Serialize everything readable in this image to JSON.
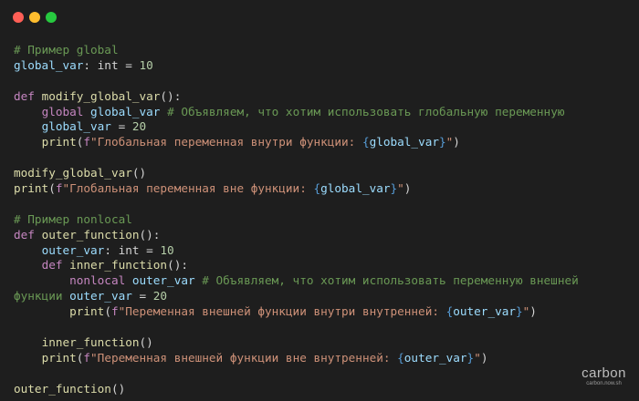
{
  "window": {
    "controls": [
      {
        "name": "close",
        "color": "#ff5f56"
      },
      {
        "name": "minimize",
        "color": "#ffbd2e"
      },
      {
        "name": "maximize",
        "color": "#27c93f"
      }
    ]
  },
  "code": {
    "lines": [
      [
        [
          "comment",
          "# Пример global"
        ]
      ],
      [
        [
          "var",
          "global_var"
        ],
        [
          "plain",
          ": int = "
        ],
        [
          "num",
          "10"
        ]
      ],
      [],
      [
        [
          "kw",
          "def "
        ],
        [
          "fn",
          "modify_global_var"
        ],
        [
          "plain",
          "():"
        ]
      ],
      [
        [
          "plain",
          "    "
        ],
        [
          "kw",
          "global "
        ],
        [
          "var",
          "global_var "
        ],
        [
          "comment",
          "# Объявляем, что хотим использовать глобальную переменную"
        ]
      ],
      [
        [
          "plain",
          "    "
        ],
        [
          "var",
          "global_var"
        ],
        [
          "plain",
          " = "
        ],
        [
          "num",
          "20"
        ]
      ],
      [
        [
          "plain",
          "    "
        ],
        [
          "fn",
          "print"
        ],
        [
          "plain",
          "("
        ],
        [
          "kw",
          "f"
        ],
        [
          "str",
          "\"Глобальная переменная внутри функции: "
        ],
        [
          "brace",
          "{"
        ],
        [
          "var",
          "global_var"
        ],
        [
          "brace",
          "}"
        ],
        [
          "str",
          "\""
        ],
        [
          "plain",
          ")"
        ]
      ],
      [],
      [
        [
          "fn",
          "modify_global_var"
        ],
        [
          "plain",
          "()"
        ]
      ],
      [
        [
          "fn",
          "print"
        ],
        [
          "plain",
          "("
        ],
        [
          "kw",
          "f"
        ],
        [
          "str",
          "\"Глобальная переменная вне функции: "
        ],
        [
          "brace",
          "{"
        ],
        [
          "var",
          "global_var"
        ],
        [
          "brace",
          "}"
        ],
        [
          "str",
          "\""
        ],
        [
          "plain",
          ")"
        ]
      ],
      [],
      [
        [
          "comment",
          "# Пример nonlocal"
        ]
      ],
      [
        [
          "kw",
          "def "
        ],
        [
          "fn",
          "outer_function"
        ],
        [
          "plain",
          "():"
        ]
      ],
      [
        [
          "plain",
          "    "
        ],
        [
          "var",
          "outer_var"
        ],
        [
          "plain",
          ": int = "
        ],
        [
          "num",
          "10"
        ]
      ],
      [
        [
          "plain",
          "    "
        ],
        [
          "kw",
          "def "
        ],
        [
          "fn",
          "inner_function"
        ],
        [
          "plain",
          "():"
        ]
      ],
      [
        [
          "plain",
          "        "
        ],
        [
          "kw",
          "nonlocal "
        ],
        [
          "var",
          "outer_var "
        ],
        [
          "comment",
          "# Объявляем, что хотим использовать переменную внешней"
        ]
      ],
      [
        [
          "comment",
          "функции "
        ],
        [
          "var",
          "outer_var"
        ],
        [
          "plain",
          " = "
        ],
        [
          "num",
          "20"
        ]
      ],
      [
        [
          "plain",
          "        "
        ],
        [
          "fn",
          "print"
        ],
        [
          "plain",
          "("
        ],
        [
          "kw",
          "f"
        ],
        [
          "str",
          "\"Переменная внешней функции внутри внутренней: "
        ],
        [
          "brace",
          "{"
        ],
        [
          "var",
          "outer_var"
        ],
        [
          "brace",
          "}"
        ],
        [
          "str",
          "\""
        ],
        [
          "plain",
          ")"
        ]
      ],
      [],
      [
        [
          "plain",
          "    "
        ],
        [
          "fn",
          "inner_function"
        ],
        [
          "plain",
          "()"
        ]
      ],
      [
        [
          "plain",
          "    "
        ],
        [
          "fn",
          "print"
        ],
        [
          "plain",
          "("
        ],
        [
          "kw",
          "f"
        ],
        [
          "str",
          "\"Переменная внешней функции вне внутренней: "
        ],
        [
          "brace",
          "{"
        ],
        [
          "var",
          "outer_var"
        ],
        [
          "brace",
          "}"
        ],
        [
          "str",
          "\""
        ],
        [
          "plain",
          ")"
        ]
      ],
      [],
      [
        [
          "fn",
          "outer_function"
        ],
        [
          "plain",
          "()"
        ]
      ]
    ]
  },
  "watermark": {
    "title": "carbon",
    "url": "carbon.now.sh"
  }
}
